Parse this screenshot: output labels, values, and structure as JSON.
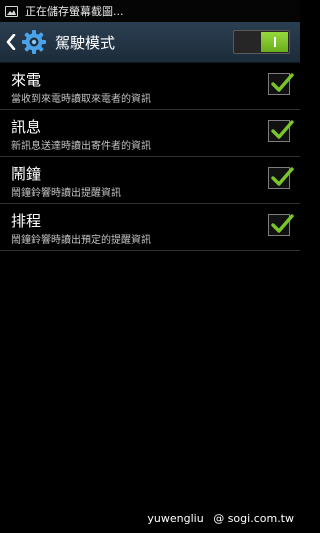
{
  "status_bar": {
    "notification_text": "正在儲存螢幕截圖...",
    "icon": "gallery-icon"
  },
  "action_bar": {
    "back_icon": "back-chevron-icon",
    "app_icon": "settings-gear-icon",
    "title": "駕駛模式",
    "master_switch_on": true,
    "accent_color": "#7ac52a"
  },
  "items": [
    {
      "title": "來電",
      "summary": "當收到來電時讀取來電者的資訊",
      "checked": true
    },
    {
      "title": "訊息",
      "summary": "新訊息送達時讀出寄件者的資訊",
      "checked": true
    },
    {
      "title": "鬧鐘",
      "summary": "鬧鐘鈴響時讀出提醒資訊",
      "checked": true
    },
    {
      "title": "排程",
      "summary": "鬧鐘鈴響時讀出預定的提醒資訊",
      "checked": true
    }
  ],
  "watermark": {
    "user": "yuwengliu",
    "site": "@ sogi.com.tw"
  }
}
